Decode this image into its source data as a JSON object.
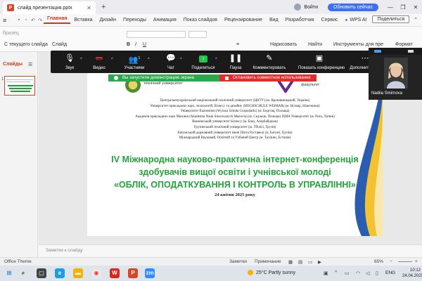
{
  "titlebar": {
    "tab_title": "слайд презентация.pptx",
    "login_label": "Войти",
    "update_label": "Обновить сейчас"
  },
  "menubar": {
    "items": [
      "Главная",
      "Вставка",
      "Дизайн",
      "Переходы",
      "Анимация",
      "Показ слайдов",
      "Рецензирование",
      "Вид",
      "Разработчик",
      "Сервис"
    ],
    "wps_ai": "WPS AI",
    "share": "Поделиться"
  },
  "ribbon": {
    "from_current": "С текущего слайда",
    "slide_label": "Слайд",
    "draw_label": "Нарисовать",
    "find_label": "Найти",
    "tools_label": "Инструменты для пре",
    "format_label": "Формат",
    "style_placeholder": "бразец"
  },
  "slides_panel": {
    "header": "Слайды",
    "slide_number": "1"
  },
  "zoom": {
    "buttons": [
      {
        "label": "Звук"
      },
      {
        "label": "Видео"
      },
      {
        "label": "Участники",
        "count": "1"
      },
      {
        "label": "Чат"
      },
      {
        "label": "Поделиться"
      },
      {
        "label": "Пауза"
      },
      {
        "label": "Комментировать"
      },
      {
        "label": "Показать конференцию"
      },
      {
        "label": "Дополнительно"
      }
    ],
    "banner_green": "Вы запустили демонстрацию экрана",
    "banner_red": "Остановить совместное использование",
    "participant_name": "Nadiia Smirnova"
  },
  "slide": {
    "logo_left_text": "національний технічний університет",
    "logo_right_text": "факультет",
    "universities": [
      "Центральноукраїнський національний технічний університет (ЦНТУ) (м. Кропивницький, Україна)",
      "Університет прикладних наук, технологій, бізнесу та дизайну (HOCHSCHULE WISMAR) (м. Вісмар, Німеччина)",
      "Університет Економіки (Wyższa Szkoła Gospodarki) (м. Бидгощ, Польща)",
      "Академія прикладних наук Мазовія (Akademia Nauk Stosowanych Mazovia) (м. Седльце, Польща) ISMA Університет (м. Рига, Латвія)",
      "Вишинський університет Бізнесу (м. Баку, Азербайджан)",
      "Грузинський технічний університет (м. Тбілісі, Грузія)",
      "Батумський державний університет імені Шота Руставелі (м. Батумі, Грузія)",
      "Міжнародний Науковий, Освітній та Учбовий Центр (м. Таллінн, Естонія)"
    ],
    "title_lines": [
      "IV Міжнародна науково-практична інтернет-конференція",
      "здобувачів вищої освіти і учнівської молоді",
      "«ОБЛІК, ОПОДАТКУВАННЯ І КОНТРОЛЬ В УПРАВЛІННІ»"
    ],
    "date": "24 квітня 2025 року"
  },
  "notes_placeholder": "Заметки к слайду",
  "statusbar": {
    "theme": "Office Theme",
    "notes": "Заметки",
    "comments": "Примечание",
    "zoom": "65%"
  },
  "taskbar": {
    "weather": "25°C  Partly sunny",
    "lang": "ENG",
    "time": "10:12",
    "date": "24.04.2025"
  },
  "colors": {
    "accent": "#c43e1c",
    "title_green": "#22a33a",
    "zoom_bar": "#1a1a1a",
    "update_blue": "#3d6ef5"
  }
}
